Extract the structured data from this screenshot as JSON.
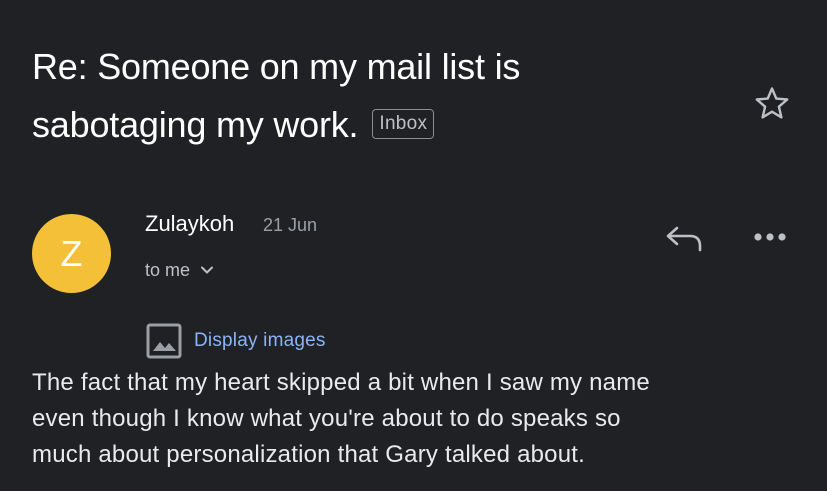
{
  "email": {
    "subject_lines": [
      "Re: Someone on my mail list is",
      "sabotaging my work."
    ],
    "label_badge": "Inbox",
    "sender": {
      "avatar_letter": "Z",
      "avatar_color": "#f3c037",
      "name": "Zulaykoh",
      "date": "21 Jun",
      "recipient": "to me"
    },
    "display_images_label": "Display images",
    "body_lines": [
      "The fact that my heart skipped a bit when I saw my name",
      "even though I know what you're about to do speaks so",
      "much about personalization that Gary talked about."
    ]
  },
  "icons": {
    "star": "star-outline-icon",
    "reply": "reply-arrow-icon",
    "more": "more-horizontal-icon",
    "chevron": "chevron-down-icon",
    "image": "image-placeholder-icon"
  },
  "colors": {
    "background": "#202124",
    "link": "#8ab4f8",
    "muted": "#9aa0a6"
  }
}
